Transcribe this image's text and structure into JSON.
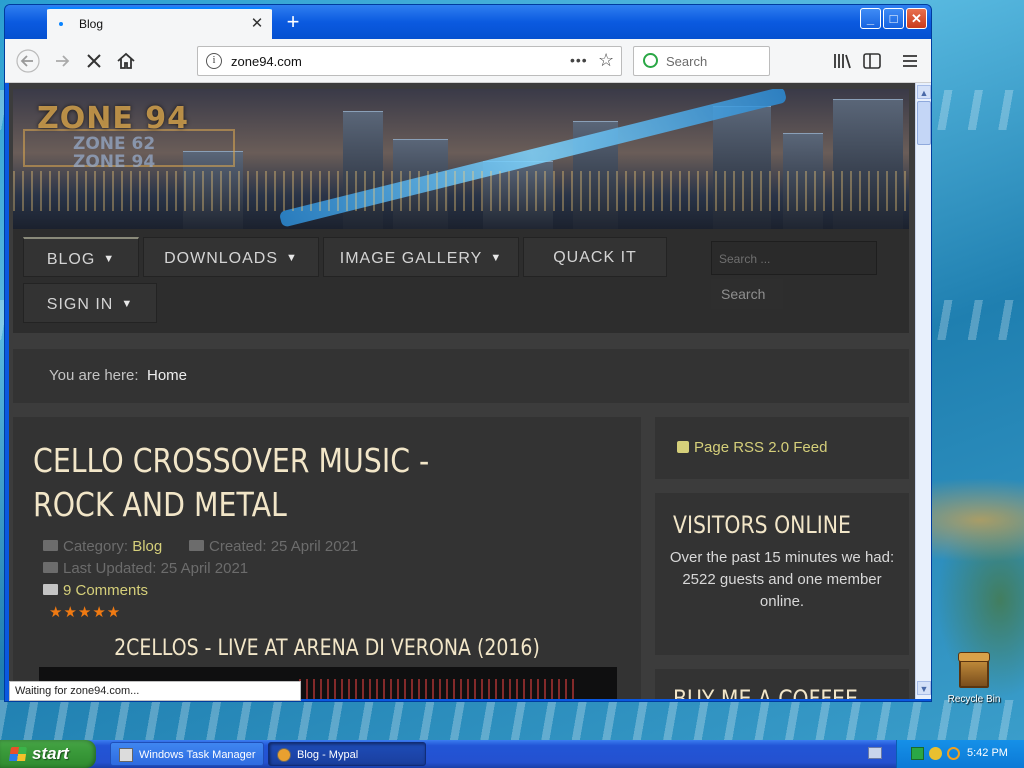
{
  "browser": {
    "tab_title": "Blog",
    "tab_close": "✕",
    "new_tab": "+",
    "window_buttons": {
      "minimize": "_",
      "maximize": "□",
      "close": "✕"
    },
    "url": "zone94.com",
    "search_placeholder": "Search",
    "status_text": "Waiting for zone94.com...",
    "icons": [
      "back-icon",
      "forward-icon",
      "stop-icon",
      "home-icon",
      "info-icon",
      "page-actions-icon",
      "bookmark-star-icon",
      "library-icon",
      "sidebar-icon",
      "menu-icon"
    ]
  },
  "site": {
    "logo": {
      "main": "ZONE 94",
      "sub_line1": "ZONE 62",
      "sub_line2": "ZONE 94"
    },
    "nav": {
      "blog": "BLOG",
      "downloads": "DOWNLOADS",
      "image_gallery": "IMAGE GALLERY",
      "quack_it": "QUACK IT",
      "sign_in": "SIGN IN",
      "search_placeholder": "Search ...",
      "search_button": "Search"
    },
    "breadcrumb": {
      "lead": "You are here:",
      "current": "Home"
    },
    "article": {
      "title": "CELLO CROSSOVER MUSIC - ROCK AND METAL",
      "category_label": "Category:",
      "category": "Blog",
      "created": "Created: 25 April 2021",
      "last_updated": "Last Updated: 25 April 2021",
      "comments": "9 Comments",
      "rating": "★★★★★",
      "rating_value": 5,
      "video_title": "2CELLOS - LIVE AT ARENA DI VERONA (2016)"
    },
    "sidebar": {
      "rss": "Page RSS 2.0 Feed",
      "visitors_title": "VISITORS ONLINE",
      "visitors_line1": "Over the past 15 minutes we had:",
      "visitors_line2": "2522 guests and one member online.",
      "coffee_title": "BUY ME A COFFEE"
    },
    "colors": {
      "accent": "#d5cf7a",
      "heading": "#f2e6c8",
      "panel": "#333333",
      "star": "#f07a12"
    }
  },
  "desktop": {
    "recycle_bin": "Recycle Bin"
  },
  "taskbar": {
    "start": "start",
    "tasks": [
      "Windows Task Manager",
      "Blog - Mypal"
    ],
    "clock": "5:42 PM"
  }
}
